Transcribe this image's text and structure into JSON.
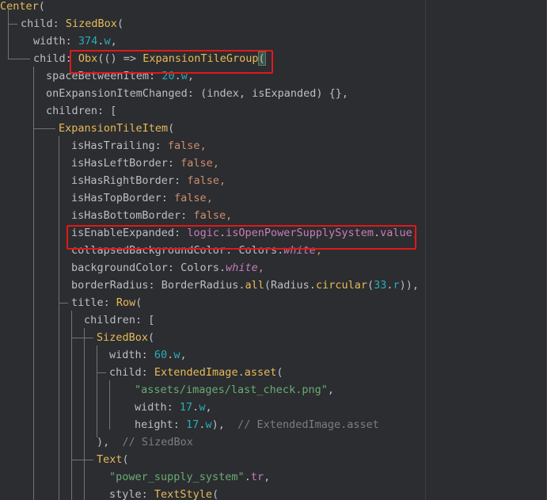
{
  "code_lines": [
    {
      "indent": 0,
      "tokens": [
        {
          "t": "Center",
          "c": "call"
        },
        {
          "t": "(",
          "c": "def"
        }
      ]
    },
    {
      "indent": 26,
      "tokens": [
        {
          "t": "child: ",
          "c": "def"
        },
        {
          "t": "SizedBox",
          "c": "call"
        },
        {
          "t": "(",
          "c": "def"
        }
      ]
    },
    {
      "indent": 42,
      "tokens": [
        {
          "t": "width: ",
          "c": "def"
        },
        {
          "t": "374",
          "c": "num"
        },
        {
          "t": ".",
          "c": "def"
        },
        {
          "t": "w",
          "c": "num"
        },
        {
          "t": ",",
          "c": "def"
        }
      ]
    },
    {
      "indent": 42,
      "tokens": [
        {
          "t": "child: ",
          "c": "def"
        },
        {
          "t": "Obx",
          "c": "call"
        },
        {
          "t": "(() => ",
          "c": "def"
        },
        {
          "t": "ExpansionTileGroup",
          "c": "call"
        },
        {
          "t": "(",
          "c": "bracket"
        }
      ]
    },
    {
      "indent": 58,
      "tokens": [
        {
          "t": "spaceBetweenItem: ",
          "c": "def"
        },
        {
          "t": "20",
          "c": "num"
        },
        {
          "t": ".",
          "c": "def"
        },
        {
          "t": "w",
          "c": "num"
        },
        {
          "t": ",",
          "c": "def"
        }
      ]
    },
    {
      "indent": 58,
      "tokens": [
        {
          "t": "onExpansionItemChanged: (index, isExpanded) {},",
          "c": "def"
        }
      ]
    },
    {
      "indent": 58,
      "tokens": [
        {
          "t": "children: [",
          "c": "def"
        }
      ]
    },
    {
      "indent": 74,
      "tokens": [
        {
          "t": "ExpansionTileItem",
          "c": "call"
        },
        {
          "t": "(",
          "c": "def"
        }
      ]
    },
    {
      "indent": 90,
      "tokens": [
        {
          "t": "isHasTrailing: ",
          "c": "def"
        },
        {
          "t": "false",
          "c": "kw"
        },
        {
          "t": ",",
          "c": "kw"
        }
      ]
    },
    {
      "indent": 90,
      "tokens": [
        {
          "t": "isHasLeftBorder: ",
          "c": "def"
        },
        {
          "t": "false",
          "c": "kw"
        },
        {
          "t": ",",
          "c": "kw"
        }
      ]
    },
    {
      "indent": 90,
      "tokens": [
        {
          "t": "isHasRightBorder: ",
          "c": "def"
        },
        {
          "t": "false",
          "c": "kw"
        },
        {
          "t": ",",
          "c": "kw"
        }
      ]
    },
    {
      "indent": 90,
      "tokens": [
        {
          "t": "isHasTopBorder: ",
          "c": "def"
        },
        {
          "t": "false",
          "c": "kw"
        },
        {
          "t": ",",
          "c": "kw"
        }
      ]
    },
    {
      "indent": 90,
      "tokens": [
        {
          "t": "isHasBottomBorder: ",
          "c": "def"
        },
        {
          "t": "false",
          "c": "kw"
        },
        {
          "t": ",",
          "c": "kw"
        }
      ]
    },
    {
      "indent": 90,
      "tokens": [
        {
          "t": "isEnableExpanded: ",
          "c": "def"
        },
        {
          "t": "logic",
          "c": "prop"
        },
        {
          "t": ".",
          "c": "def"
        },
        {
          "t": "isOpenPowerSupplySystem",
          "c": "prop"
        },
        {
          "t": ".",
          "c": "def"
        },
        {
          "t": "value",
          "c": "prop"
        },
        {
          "t": ",",
          "c": "def"
        }
      ]
    },
    {
      "indent": 90,
      "tokens": [
        {
          "t": "collapsedBackgroundColor: Colors.",
          "c": "def"
        },
        {
          "t": "white",
          "c": "ital"
        },
        {
          "t": ",",
          "c": "kw"
        }
      ]
    },
    {
      "indent": 90,
      "tokens": [
        {
          "t": "backgroundColor: Colors.",
          "c": "def"
        },
        {
          "t": "white",
          "c": "ital"
        },
        {
          "t": ",",
          "c": "kw"
        }
      ]
    },
    {
      "indent": 90,
      "tokens": [
        {
          "t": "borderRadius: ",
          "c": "def"
        },
        {
          "t": "BorderRadius",
          "c": "def"
        },
        {
          "t": ".",
          "c": "def"
        },
        {
          "t": "all",
          "c": "call"
        },
        {
          "t": "(",
          "c": "def"
        },
        {
          "t": "Radius",
          "c": "def"
        },
        {
          "t": ".",
          "c": "def"
        },
        {
          "t": "circular",
          "c": "call"
        },
        {
          "t": "(",
          "c": "def"
        },
        {
          "t": "33",
          "c": "num"
        },
        {
          "t": ".",
          "c": "def"
        },
        {
          "t": "r",
          "c": "num"
        },
        {
          "t": ")),",
          "c": "def"
        }
      ]
    },
    {
      "indent": 90,
      "tokens": [
        {
          "t": "title: ",
          "c": "def"
        },
        {
          "t": "Row",
          "c": "call"
        },
        {
          "t": "(",
          "c": "def"
        }
      ]
    },
    {
      "indent": 106,
      "tokens": [
        {
          "t": "children: [",
          "c": "def"
        }
      ]
    },
    {
      "indent": 122,
      "tokens": [
        {
          "t": "SizedBox",
          "c": "call"
        },
        {
          "t": "(",
          "c": "def"
        }
      ]
    },
    {
      "indent": 138,
      "tokens": [
        {
          "t": "width: ",
          "c": "def"
        },
        {
          "t": "60",
          "c": "num"
        },
        {
          "t": ".",
          "c": "def"
        },
        {
          "t": "w",
          "c": "num"
        },
        {
          "t": ",",
          "c": "def"
        }
      ]
    },
    {
      "indent": 138,
      "tokens": [
        {
          "t": "child: ",
          "c": "def"
        },
        {
          "t": "ExtendedImage",
          "c": "call"
        },
        {
          "t": ".",
          "c": "def"
        },
        {
          "t": "asset",
          "c": "call"
        },
        {
          "t": "(",
          "c": "def"
        }
      ]
    },
    {
      "indent": 170,
      "tokens": [
        {
          "t": "\"assets/images/last_check.png\"",
          "c": "str"
        },
        {
          "t": ",",
          "c": "def"
        }
      ]
    },
    {
      "indent": 170,
      "tokens": [
        {
          "t": "width: ",
          "c": "def"
        },
        {
          "t": "17",
          "c": "num"
        },
        {
          "t": ".",
          "c": "def"
        },
        {
          "t": "w",
          "c": "num"
        },
        {
          "t": ",",
          "c": "def"
        }
      ]
    },
    {
      "indent": 170,
      "tokens": [
        {
          "t": "height: ",
          "c": "def"
        },
        {
          "t": "17",
          "c": "num"
        },
        {
          "t": ".",
          "c": "def"
        },
        {
          "t": "w",
          "c": "num"
        },
        {
          "t": "),  ",
          "c": "def"
        },
        {
          "t": "// ExtendedImage.asset",
          "c": "com"
        }
      ]
    },
    {
      "indent": 122,
      "tokens": [
        {
          "t": "),  ",
          "c": "def"
        },
        {
          "t": "// SizedBox",
          "c": "com"
        }
      ]
    },
    {
      "indent": 122,
      "tokens": [
        {
          "t": "Text",
          "c": "call"
        },
        {
          "t": "(",
          "c": "def"
        }
      ]
    },
    {
      "indent": 138,
      "tokens": [
        {
          "t": "\"power_supply_system\"",
          "c": "str"
        },
        {
          "t": ".",
          "c": "def"
        },
        {
          "t": "tr",
          "c": "prop"
        },
        {
          "t": ",",
          "c": "def"
        }
      ]
    },
    {
      "indent": 138,
      "tokens": [
        {
          "t": "style: ",
          "c": "def"
        },
        {
          "t": "TextStyle",
          "c": "call"
        },
        {
          "t": "(",
          "c": "def"
        }
      ]
    }
  ]
}
